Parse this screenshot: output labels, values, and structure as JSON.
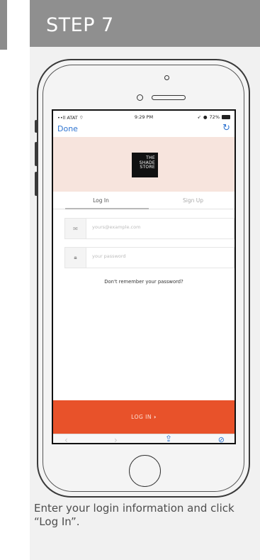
{
  "step": {
    "title": "STEP 7"
  },
  "phone_screen": {
    "status_bar": {
      "carrier": "ATAT",
      "time": "9:29 PM",
      "battery": "72%"
    },
    "nav": {
      "done_label": "Done",
      "reload_icon": "reload-icon"
    },
    "logo": {
      "line1": "THE",
      "line2": "SHADE",
      "line3": "STORE"
    },
    "tabs": [
      {
        "label": "Log In",
        "active": true
      },
      {
        "label": "Sign Up",
        "active": false
      }
    ],
    "email_field": {
      "placeholder": "yours@example.com",
      "icon": "envelope-icon"
    },
    "password_field": {
      "placeholder": "your password",
      "icon": "lock-icon"
    },
    "forgot_link": "Don't remember your password?",
    "login_button": {
      "label": "LOG IN",
      "chevron": "›"
    },
    "toolbar": {
      "back": "‹",
      "forward": "›",
      "share": "share-icon",
      "compass": "compass-icon"
    },
    "colors": {
      "accent_blue": "#2f74d0",
      "login_orange": "#e8522a",
      "brand_band": "#f7e4dd"
    }
  },
  "caption": "Enter your login information and click “Log In”."
}
